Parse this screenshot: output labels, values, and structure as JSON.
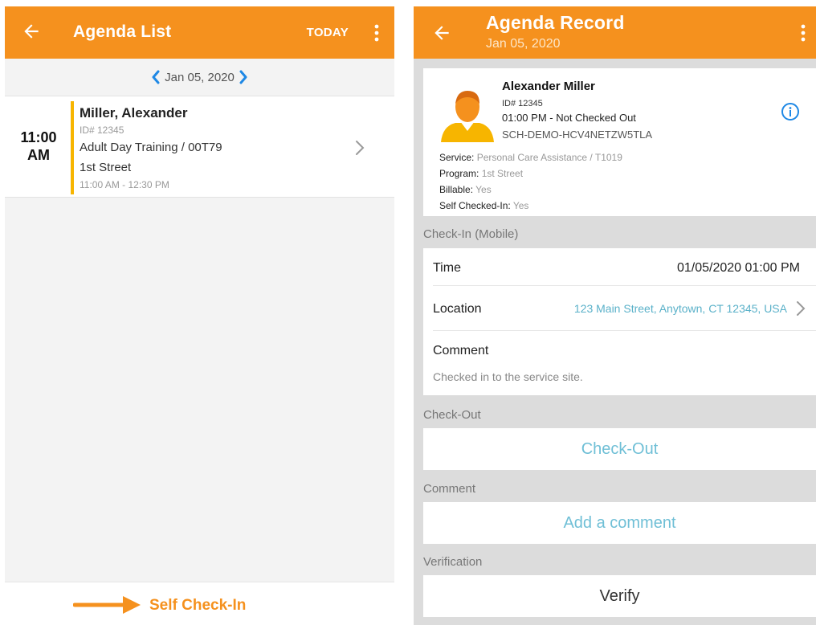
{
  "left": {
    "appbar": {
      "title": "Agenda List",
      "today": "TODAY"
    },
    "date_nav": {
      "date": "Jan 05, 2020"
    },
    "agenda_items": [
      {
        "time_line1": "11:00",
        "time_line2": "AM",
        "name": "Miller, Alexander",
        "id": "ID# 12345",
        "service": "Adult Day Training / 00T79",
        "program": "1st Street",
        "span": "11:00 AM - 12:30 PM"
      }
    ],
    "footer": {
      "label": "Self Check-In"
    }
  },
  "right": {
    "appbar": {
      "title": "Agenda Record",
      "subtitle": "Jan 05, 2020"
    },
    "client": {
      "name": "Alexander Miller",
      "id": "ID# 12345",
      "status": "01:00 PM - Not Checked Out",
      "code": "SCH-DEMO-HCV4NETZW5TLA",
      "details": [
        {
          "label": "Service: ",
          "value": "Personal Care Assistance / T1019"
        },
        {
          "label": "Program: ",
          "value": "1st Street"
        },
        {
          "label": "Billable: ",
          "value": "Yes"
        },
        {
          "label": "Self Checked-In: ",
          "value": "Yes"
        }
      ]
    },
    "checkin": {
      "section_label": "Check-In (Mobile)",
      "time_label": "Time",
      "time_value": "01/05/2020 01:00 PM",
      "location_label": "Location",
      "location_value": "123 Main Street, Anytown, CT 12345, USA",
      "comment_label": "Comment",
      "comment_value": "Checked in to the service site."
    },
    "checkout": {
      "section_label": "Check-Out",
      "button": "Check-Out"
    },
    "comment": {
      "section_label": "Comment",
      "button": "Add a comment"
    },
    "verification": {
      "section_label": "Verification",
      "button": "Verify"
    }
  },
  "colors": {
    "accent": "#f5911e",
    "link": "#6fbfd6",
    "bar": "#f7b500",
    "nav_blue": "#1e88e5"
  }
}
